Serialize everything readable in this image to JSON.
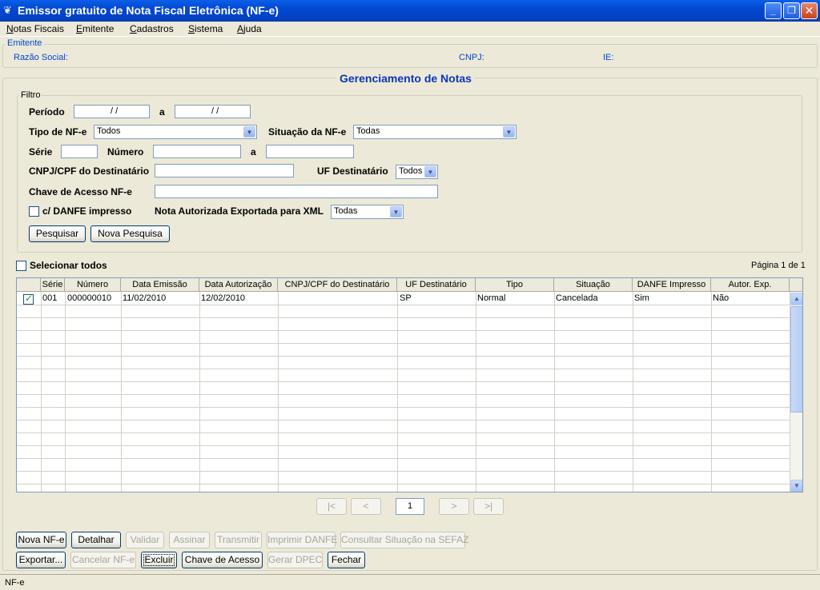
{
  "window": {
    "title": "Emissor gratuito de Nota Fiscal Eletrônica (NF-e)",
    "min_glyph": "_",
    "restore_glyph": "❐",
    "close_glyph": "✕"
  },
  "menu": [
    {
      "accel": "N",
      "rest": "otas Fiscais"
    },
    {
      "accel": "E",
      "rest": "mitente"
    },
    {
      "accel": "C",
      "rest": "adastros"
    },
    {
      "accel": "S",
      "rest": "istema"
    },
    {
      "accel": "A",
      "rest": "juda"
    }
  ],
  "emitente": {
    "legend": "Emitente",
    "razao_label": "Razão Social:",
    "cnpj_label": "CNPJ:",
    "ie_label": "IE:"
  },
  "panel": {
    "title": "Gerenciamento de Notas"
  },
  "filtro": {
    "legend": "Filtro",
    "periodo_label": "Período",
    "periodo_from": "  / /",
    "periodo_sep": "a",
    "periodo_to": "  / /",
    "tipo_label": "Tipo de NF-e",
    "tipo_value": "Todos",
    "situacao_label": "Situação da NF-e",
    "situacao_value": "Todas",
    "serie_label": "Série",
    "serie_value": "",
    "numero_label": "Número",
    "numero_from": "",
    "numero_sep": "a",
    "numero_to": "",
    "cnpj_label": "CNPJ/CPF do Destinatário",
    "cnpj_value": "",
    "uf_label": "UF Destinatário",
    "uf_value": "Todos",
    "chave_label": "Chave de Acesso NF-e",
    "chave_value": "",
    "danfe_label": "c/ DANFE impresso",
    "exportada_label": "Nota Autorizada Exportada para XML",
    "exportada_value": "Todas",
    "pesquisar": "Pesquisar",
    "nova_pesquisa": "Nova Pesquisa"
  },
  "grid": {
    "select_all": "Selecionar todos",
    "pagina": "Página 1 de 1",
    "columns": [
      "Série",
      "Número",
      "Data Emissão",
      "Data Autorização",
      "CNPJ/CPF do Destinatário",
      "UF Destinatário",
      "Tipo",
      "Situação",
      "DANFE Impresso",
      "Autor. Exp."
    ],
    "rows": [
      {
        "checked": true,
        "serie": "001",
        "numero": "000000010",
        "emissao": "11/02/2010",
        "autorizacao": "12/02/2010",
        "cnpj": "",
        "uf": "SP",
        "tipo": "Normal",
        "situacao": "Cancelada",
        "danfe": "Sim",
        "autor_exp": "Não"
      }
    ]
  },
  "pagination": {
    "first": "|<",
    "prev": "<",
    "page": "1",
    "next": ">",
    "last": ">|"
  },
  "actions": {
    "nova": "Nova NF-e",
    "detalhar": "Detalhar",
    "validar": "Validar",
    "assinar": "Assinar",
    "transmitir": "Transmitir",
    "imprimir": "Imprimir DANFE",
    "consultar": "Consultar Situação na SEFAZ",
    "exportar": "Exportar...",
    "cancelar": "Cancelar NF-e",
    "excluir": "Excluir",
    "chave": "Chave de Acesso",
    "dpec": "Gerar DPEC",
    "fechar": "Fechar"
  },
  "status": {
    "text": "NF-e"
  }
}
